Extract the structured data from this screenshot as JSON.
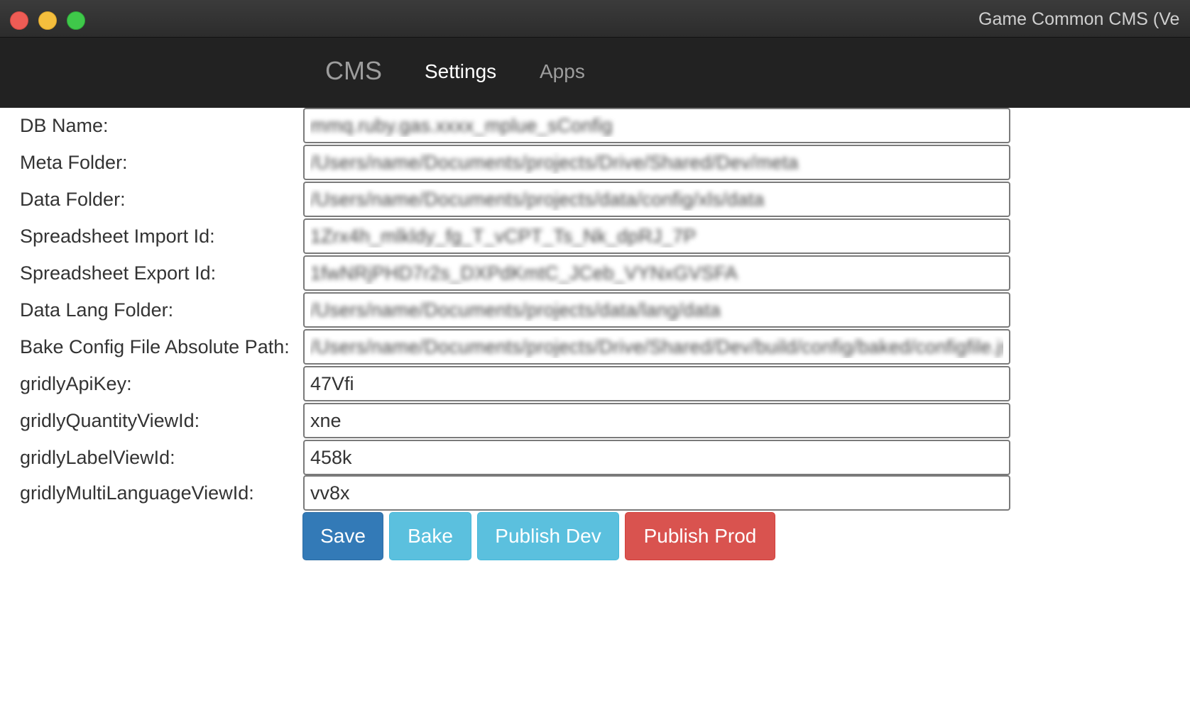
{
  "window": {
    "title": "Game Common CMS (Ve"
  },
  "navbar": {
    "brand": "CMS",
    "links": [
      {
        "label": "Settings",
        "active": true
      },
      {
        "label": "Apps",
        "active": false
      }
    ]
  },
  "form": {
    "fields": [
      {
        "label": "DB Name:",
        "value": "mmq.ruby.gas.xxxx_mplue_sConfig"
      },
      {
        "label": "Meta Folder:",
        "value": "/Users/name/Documents/projects/Drive/Shared/Dev/meta"
      },
      {
        "label": "Data Folder:",
        "value": "/Users/name/Documents/projects/data/config/xls/data"
      },
      {
        "label": "Spreadsheet Import Id:",
        "value": "1Zrx4h_mlkldy_fg_T_vCPT_Ts_Nk_dpRJ_7P"
      },
      {
        "label": "Spreadsheet Export Id:",
        "value": "1fwNRjPHD7r2s_DXPdKmtC_JCeb_VYNxGVSFA"
      },
      {
        "label": "Data Lang Folder:",
        "value": "/Users/name/Documents/projects/data/lang/data"
      },
      {
        "label": "Bake Config File Absolute Path:",
        "value": "/Users/name/Documents/projects/Drive/Shared/Dev/build/config/baked/configfile.json"
      },
      {
        "label": "gridlyApiKey:",
        "value": "47Vfi"
      },
      {
        "label": "gridlyQuantityViewId:",
        "value": "xne"
      },
      {
        "label": "gridlyLabelViewId:",
        "value": "458k"
      },
      {
        "label": "gridlyMultiLanguageViewId:",
        "value": "vv8x"
      }
    ]
  },
  "actions": {
    "save": "Save",
    "bake": "Bake",
    "publish_dev": "Publish Dev",
    "publish_prod": "Publish Prod"
  },
  "colors": {
    "primary": "#337ab7",
    "info": "#5bc0de",
    "danger": "#d9534f",
    "navbar": "#222222"
  }
}
